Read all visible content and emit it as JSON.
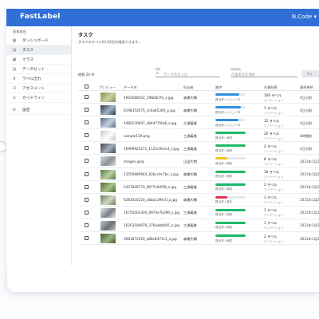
{
  "app": {
    "logo": "FastLabel",
    "account": "N.Code ▾"
  },
  "sidebar": {
    "project": "画像検出",
    "items": [
      {
        "label": "ダッシュボード",
        "icon": "dashboard-icon",
        "glyph": "▦"
      },
      {
        "label": "タスク",
        "icon": "task-icon",
        "glyph": "▤",
        "active": true
      },
      {
        "label": "クラス",
        "icon": "class-icon",
        "glyph": "▣"
      },
      {
        "label": "データセット",
        "icon": "dataset-icon",
        "glyph": "▤"
      },
      {
        "label": "ラベル出力",
        "icon": "download-icon",
        "glyph": "⬇"
      },
      {
        "label": "アセスメント",
        "icon": "assessment-icon",
        "glyph": "☑"
      },
      {
        "label": "ガイドライン",
        "icon": "guideline-icon",
        "glyph": "≡"
      },
      {
        "label": "設定",
        "icon": "settings-icon",
        "glyph": "⚙"
      }
    ]
  },
  "main": {
    "title": "タスク",
    "description": "タスクのラベル付け状況を確認できます。",
    "count": "総数 26 件",
    "search": {
      "label": "検索",
      "placeholder": "データ名を入力"
    },
    "assignee_filter": {
      "label": "作業者名",
      "placeholder": "作業者名を選択"
    },
    "filter_button": "フィ",
    "columns": [
      "プレビュー",
      "データ名",
      "担当者",
      "進捗",
      "作業結果",
      "最終更新"
    ]
  },
  "rows": [
    {
      "name": "4962088502_1f8b0b7fe_z.jpg",
      "assignee": "森橋大輔",
      "progress": 80,
      "color": "#2f8fe0",
      "status": "提出済 / レビュー中",
      "labels": "106 ラベル",
      "sublabel": "アノテーション",
      "updated": "4日分前"
    },
    {
      "name": "6198352075_1c6a85300_p.jpg",
      "assignee": "森橋大輔",
      "progress": 85,
      "color": "#2f8fe0",
      "status": "提出済 / レビュー中",
      "labels": "1 ラベル",
      "sublabel": "アノテーション",
      "updated": "4日分前"
    },
    {
      "name": "4480130607_d84d77f4e8_z.jpg",
      "assignee": "三浦義美",
      "progress": 75,
      "color": "#2f8fe0",
      "status": "提出済 / レビュー中",
      "labels": "12 ラベル",
      "sublabel": "アノテーション",
      "updated": "4日分前"
    },
    {
      "name": "sample119.png",
      "assignee": "三浦義美",
      "progress": 100,
      "color": "#1fb86a",
      "status": "提出済 / 承認",
      "labels": "20 ラベル",
      "sublabel": "アノテーション",
      "updated": "4時間前"
    },
    {
      "name": "16969925271_1125c9e1e4_z.jpg",
      "assignee": "三浦義美",
      "progress": 100,
      "color": "#1fb86a",
      "status": "提出済 / 承認",
      "labels": "2 ラベル",
      "sublabel": "アノテーション",
      "updated": "4日分前"
    },
    {
      "name": "images.jpeg",
      "assignee": "山田大朗",
      "progress": 40,
      "color": "#f0c419",
      "status": "提出済 / 承認",
      "labels": "8 ラベル",
      "sublabel": "アノテーション",
      "updated": "2021年1月25日"
    },
    {
      "name": "13559889944_82bcc9c7bc_z.jpg",
      "assignee": "森橋大輔",
      "progress": 100,
      "color": "#1fb86a",
      "status": "提出済 / 承認",
      "labels": "10 ラベル",
      "sublabel": "アノテーション",
      "updated": "2021年1月25日"
    },
    {
      "name": "2427849770_9677c645f8_z.jpg",
      "assignee": "三浦義美",
      "progress": 100,
      "color": "#1fb86a",
      "status": "提出済 / 承認",
      "labels": "2 ラベル",
      "sublabel": "アノテーション",
      "updated": "2021年1月25日"
    },
    {
      "name": "6283016120_a8ba1394c0_z.jpg",
      "assignee": "森橋大輔",
      "progress": 40,
      "color": "#e0355a",
      "status": "提出済 / 差戻",
      "labels": "1 ラベル",
      "sublabel": "アノテーション",
      "updated": "2021年1月25日"
    },
    {
      "name": "26755403300_8974e7b399_z.jpg",
      "assignee": "三浦義美",
      "progress": 100,
      "color": "#1fb86a",
      "status": "提出済 / 承認",
      "labels": "1 ラベル",
      "sublabel": "アノテーション",
      "updated": "2021年1月25日"
    },
    {
      "name": "16203184070_376aabbb05_z.jpg",
      "assignee": "三浦義美",
      "progress": 100,
      "color": "#1fb86a",
      "status": "提出済 / 承認",
      "labels": "1 ラベル",
      "sublabel": "アノテーション",
      "updated": "2021年1月25日"
    },
    {
      "name": "3081872020_a88c8473c1_z.jpg",
      "assignee": "森橋大輔",
      "progress": 100,
      "color": "#1fb86a",
      "status": "提出済 / 承認",
      "labels": "2 ラベル",
      "sublabel": "アノテーション",
      "updated": "2021年1月25日"
    }
  ]
}
